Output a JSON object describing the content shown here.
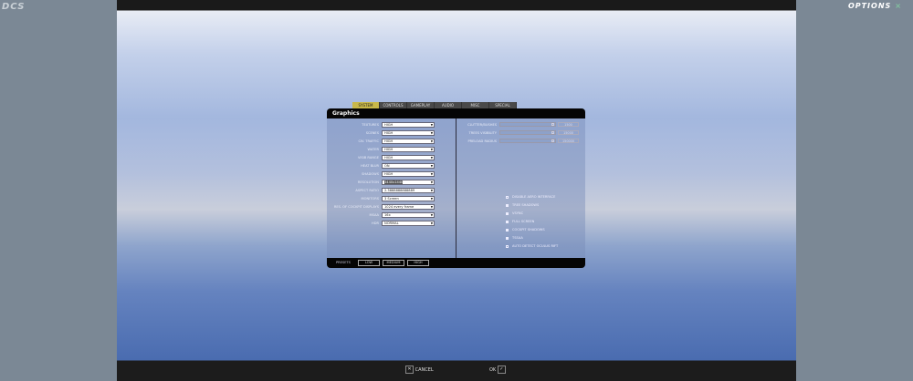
{
  "logo": "DCS",
  "title": "OPTIONS",
  "tabs": [
    "SYSTEM",
    "CONTROLS",
    "GAMEPLAY",
    "AUDIO",
    "MISC",
    "SPECIAL"
  ],
  "panel_title": "Graphics",
  "settings": [
    {
      "label": "TEXTURES",
      "value": "HIGH"
    },
    {
      "label": "SCENES",
      "value": "HIGH"
    },
    {
      "label": "CIV. TRAFFIC",
      "value": "HIGH"
    },
    {
      "label": "WATER",
      "value": "HIGH"
    },
    {
      "label": "VISIB RANGE",
      "value": "HIGH"
    },
    {
      "label": "HEAT BLUR",
      "value": "ON"
    },
    {
      "label": "SHADOWS",
      "value": "HIGH"
    },
    {
      "label": "RESOLUTION",
      "value": "3440x1440"
    },
    {
      "label": "ASPECT RATIO",
      "value": "2.3888888888889"
    },
    {
      "label": "MONITORS",
      "value": "3 Screen"
    },
    {
      "label": "RES. OF COCKPIT DISPLAYS",
      "value": "1024 every frame"
    },
    {
      "label": "MSAA",
      "value": "16x"
    },
    {
      "label": "HDR",
      "value": "NORMAL"
    }
  ],
  "sliders": [
    {
      "label": "CLUTTER/BUSHES",
      "value": "1500"
    },
    {
      "label": "TREES VISIBILITY",
      "value": "15000"
    },
    {
      "label": "PRELOAD RADIUS",
      "value": "150000"
    }
  ],
  "checkboxes": [
    {
      "label": "DISABLE AERO INTERFACE",
      "checked": false
    },
    {
      "label": "TREE SHADOWS",
      "checked": true
    },
    {
      "label": "VSYNC",
      "checked": true
    },
    {
      "label": "FULL SCREEN",
      "checked": true
    },
    {
      "label": "COCKPIT SHADOWS",
      "checked": true
    },
    {
      "label": "TSSAA",
      "checked": true
    },
    {
      "label": "AUTO DETECT OCULUS RIFT",
      "checked": false
    }
  ],
  "presets": {
    "label": "PRESETS",
    "low": "LOW",
    "medium": "MEDIUM",
    "high": "HIGH"
  },
  "footer": {
    "cancel": "CANCEL",
    "ok": "OK"
  }
}
